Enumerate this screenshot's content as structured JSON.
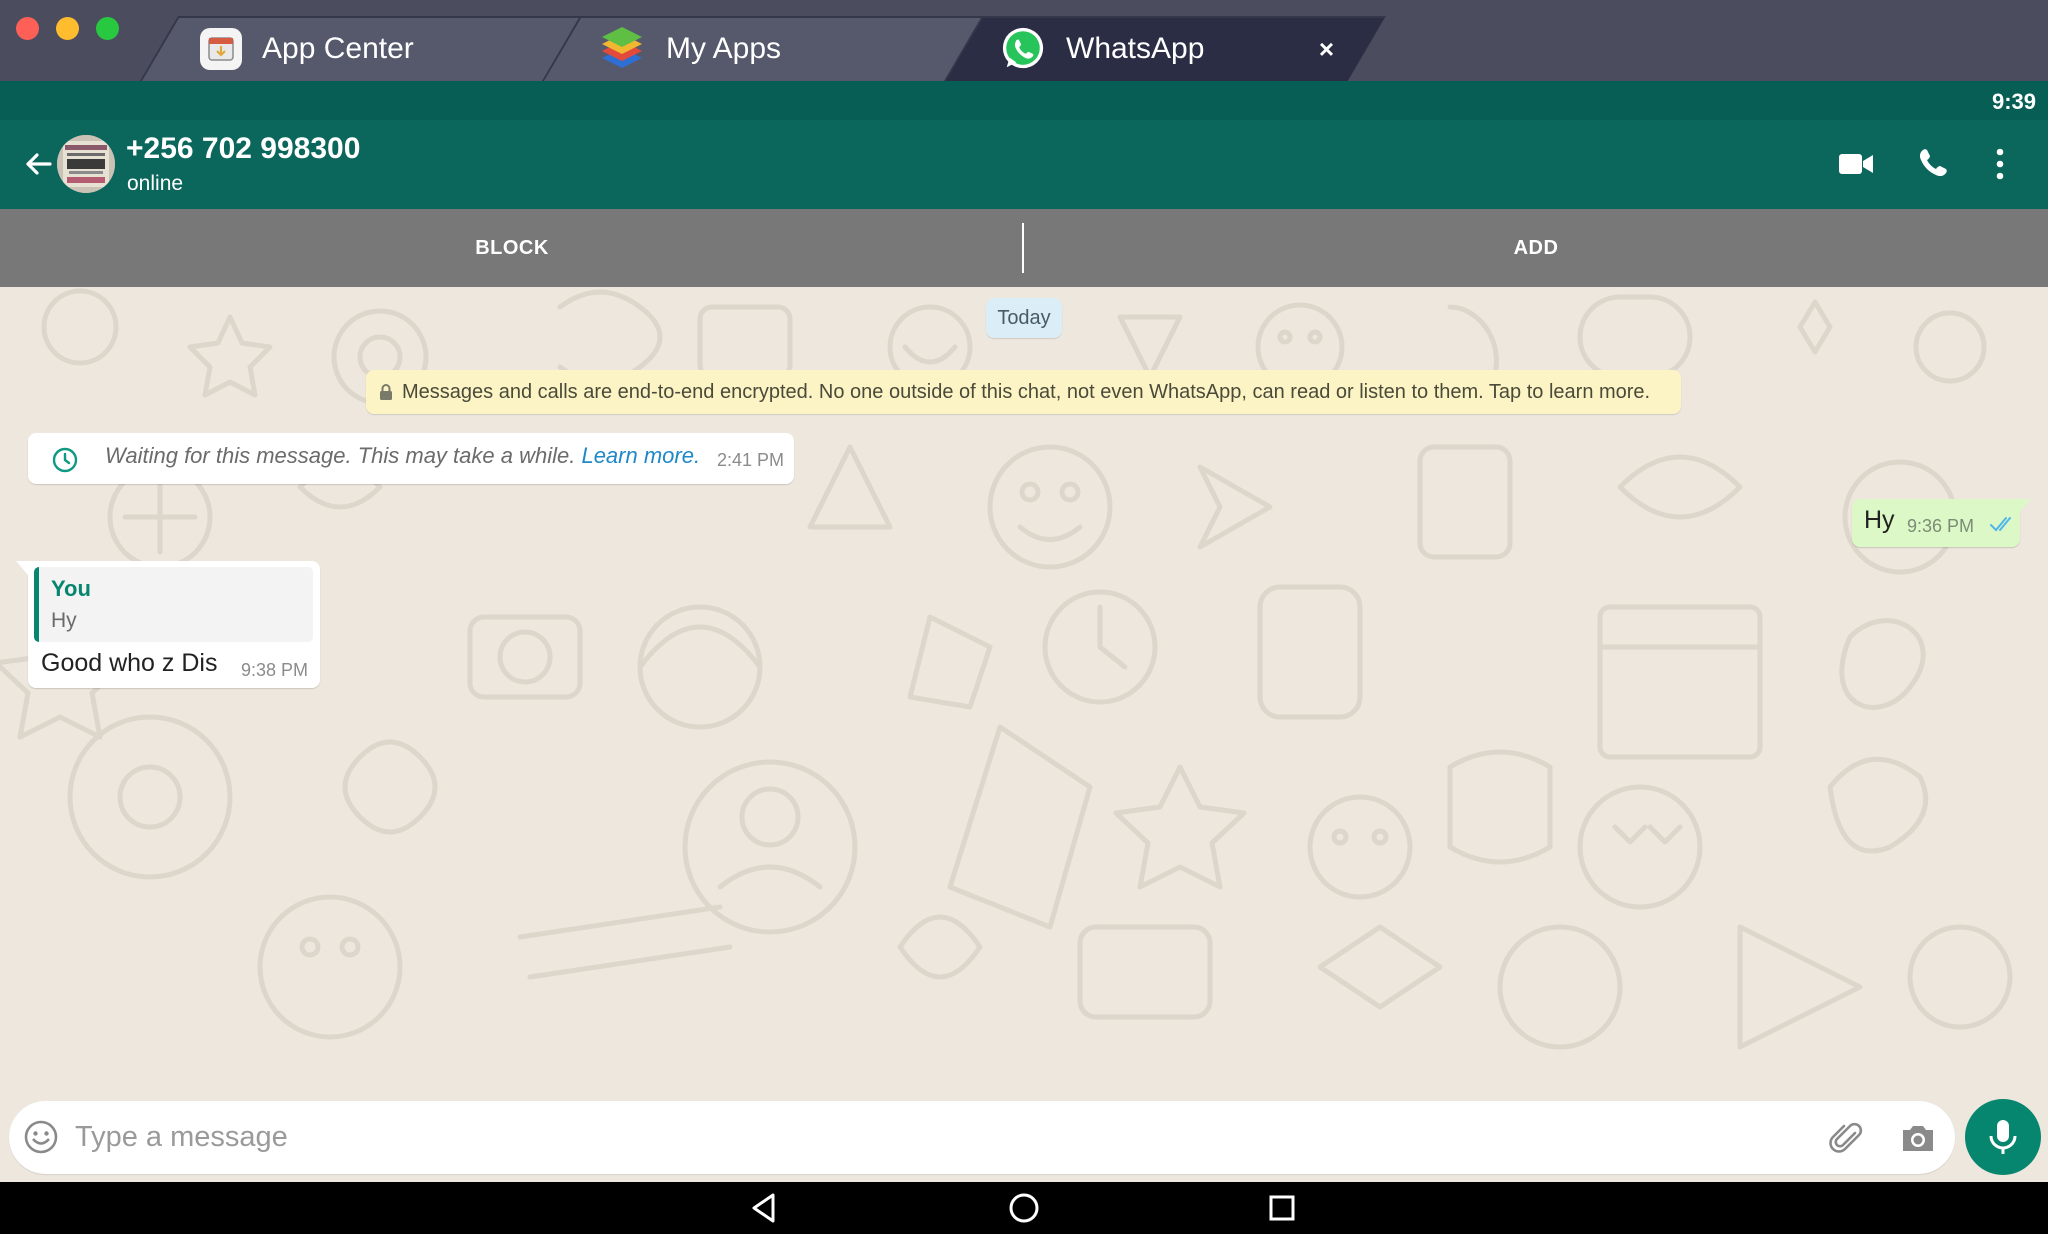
{
  "window": {
    "tabs": [
      {
        "label": "App Center",
        "icon": "app-center-icon",
        "active": false
      },
      {
        "label": "My Apps",
        "icon": "my-apps-icon",
        "active": false
      },
      {
        "label": "WhatsApp",
        "icon": "whatsapp-icon",
        "active": true
      }
    ],
    "close_label": "×"
  },
  "status_bar": {
    "time": "9:39"
  },
  "header": {
    "contact_name": "+256 702 998300",
    "contact_status": "online",
    "icons": [
      "back-arrow-icon",
      "video-call-icon",
      "phone-call-icon",
      "more-options-icon"
    ]
  },
  "action_bar": {
    "block_label": "BLOCK",
    "add_label": "ADD"
  },
  "chat": {
    "date_chip": "Today",
    "encryption_notice": "Messages and calls are end-to-end encrypted. No one outside of this chat, not even WhatsApp, can read or listen to them. Tap to learn more.",
    "waiting_message": {
      "text": "Waiting for this message. This may take a while. ",
      "link": "Learn more",
      "suffix": ".",
      "time": "2:41 PM"
    },
    "outgoing_message": {
      "text": "Hy",
      "time": "9:36 PM",
      "status": "read"
    },
    "reply_message": {
      "quoted_author": "You",
      "quoted_text": "Hy",
      "text": "Good who z Dis",
      "time": "9:38 PM"
    }
  },
  "composer": {
    "placeholder": "Type a message"
  },
  "colors": {
    "header": "#075e54",
    "accent": "#07866f",
    "outgoing_bubble": "#dcf8c6",
    "chat_background": "#ede7de",
    "link": "#1e88c8"
  }
}
